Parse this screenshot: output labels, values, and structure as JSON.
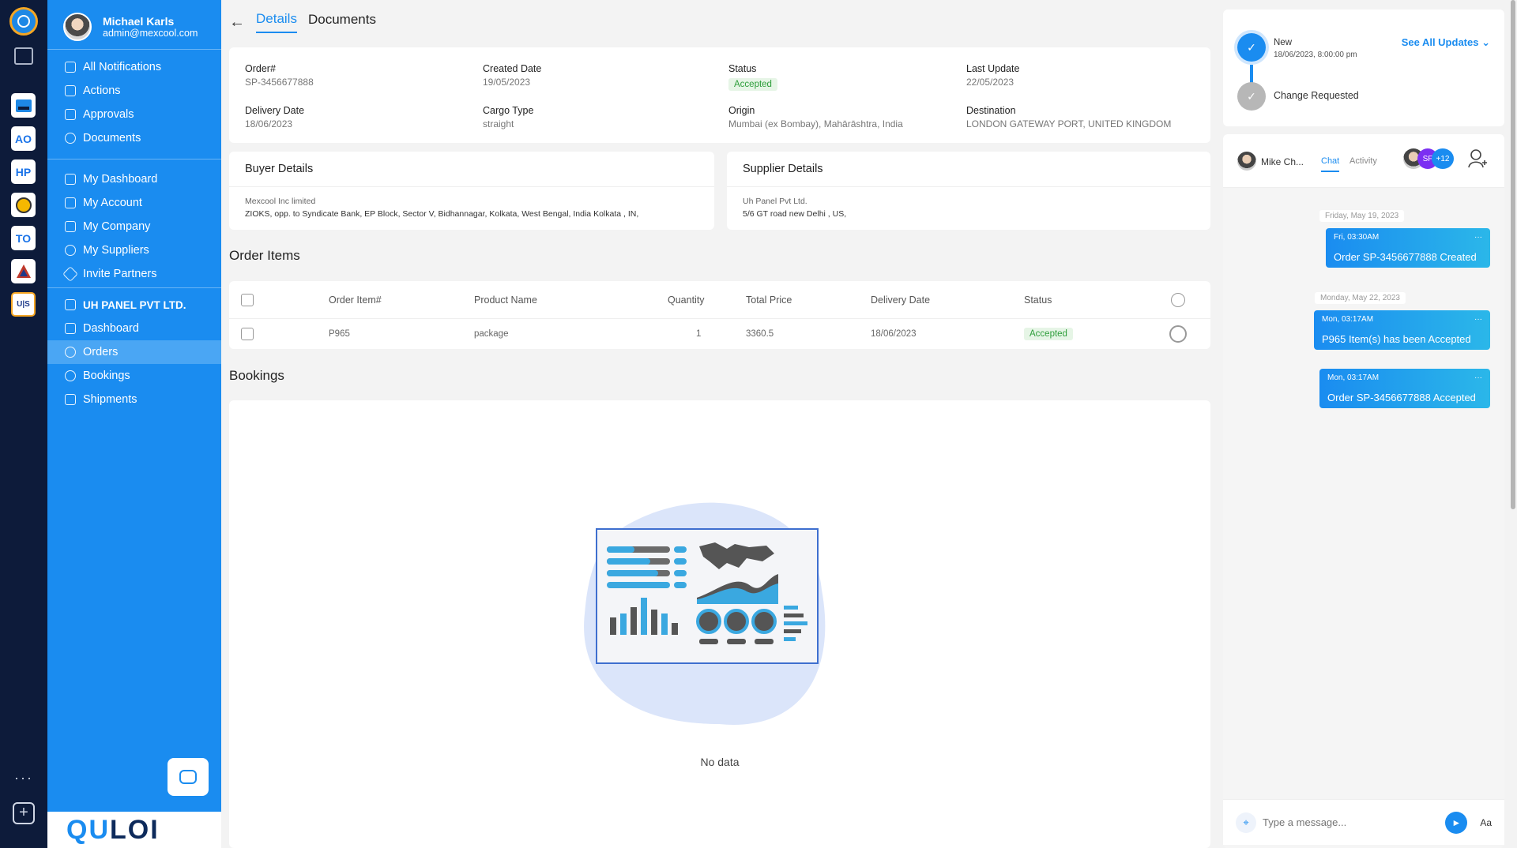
{
  "rail": {
    "apps": [
      "AO",
      "HP",
      "TO",
      "U|S"
    ]
  },
  "user": {
    "name": "Michael Karls",
    "email": "admin@mexcool.com"
  },
  "nav": {
    "group1": [
      "All Notifications",
      "Actions",
      "Approvals",
      "Documents"
    ],
    "group2": [
      "My Dashboard",
      "My Account",
      "My Company",
      "My Suppliers",
      "Invite Partners"
    ],
    "company": "UH PANEL PVT LTD.",
    "group3": [
      "Dashboard",
      "Orders",
      "Bookings",
      "Shipments"
    ],
    "active": "Orders"
  },
  "brand": {
    "logo_text_a": "QU",
    "logo_text_b": "LOI"
  },
  "tabs": [
    "Details",
    "Documents"
  ],
  "order": {
    "order_label": "Order#",
    "order_value": "SP-3456677888",
    "created_label": "Created Date",
    "created_value": "19/05/2023",
    "status_label": "Status",
    "status_value": "Accepted",
    "update_label": "Last Update",
    "update_value": "22/05/2023",
    "delivery_label": "Delivery Date",
    "delivery_value": "18/06/2023",
    "cargo_label": "Cargo Type",
    "cargo_value": "straight",
    "origin_label": "Origin",
    "origin_value": "Mumbai (ex Bombay), Mahārāshtra, India",
    "dest_label": "Destination",
    "dest_value": "LONDON GATEWAY PORT, UNITED KINGDOM"
  },
  "buyer": {
    "title": "Buyer Details",
    "name": "Mexcool Inc limited",
    "address": "ZIOKS, opp. to Syndicate Bank, EP Block, Sector V, Bidhannagar, Kolkata, West Bengal, India Kolkata , IN,"
  },
  "supplier": {
    "title": "Supplier Details",
    "name": "Uh Panel Pvt Ltd.",
    "address": "5/6 GT road new Delhi , US,"
  },
  "order_items": {
    "title": "Order Items",
    "headers": [
      "Order Item#",
      "Product Name",
      "Quantity",
      "Total Price",
      "Delivery Date",
      "Status"
    ],
    "rows": [
      {
        "item": "P965",
        "product": "package",
        "qty": "1",
        "price": "3360.5",
        "date": "18/06/2023",
        "status": "Accepted"
      }
    ]
  },
  "bookings": {
    "title": "Bookings",
    "empty": "No data"
  },
  "updates": {
    "new_label": "New",
    "new_time": "18/06/2023, 8:00:00 pm",
    "change_label": "Change Requested",
    "see_all": "See All Updates"
  },
  "chat": {
    "contact": "Mike Ch...",
    "tab_chat": "Chat",
    "tab_activity": "Activity",
    "avatar_initials": "SF",
    "avatar_more": "+12",
    "day1": "Friday, May 19, 2023",
    "msg1_time": "Fri, 03:30AM",
    "msg1_text": "Order SP-3456677888 Created",
    "day2": "Monday, May 22, 2023",
    "msg2_time": "Mon, 03:17AM",
    "msg2_text": "P965 Item(s) has been Accepted",
    "msg3_time": "Mon, 03:17AM",
    "msg3_text": "Order SP-3456677888 Accepted",
    "placeholder": "Type a message...",
    "font_toggle": "Aa"
  },
  "colors": {
    "accent": "#1a8cf0",
    "rail": "#0d1b3a",
    "success": "#2e9e3b"
  }
}
